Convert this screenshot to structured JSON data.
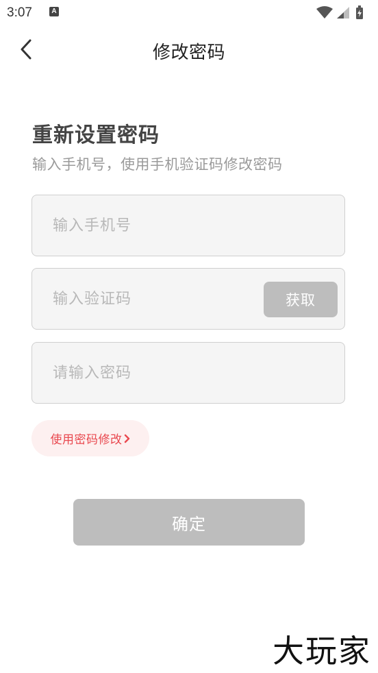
{
  "status_bar": {
    "time": "3:07",
    "notification_icon": "a-notification-icon",
    "notification_letter": "A",
    "icons": [
      "wifi-icon",
      "cell-signal-icon",
      "battery-icon"
    ]
  },
  "header": {
    "title": "修改密码",
    "back_icon": "chevron-left-icon"
  },
  "main": {
    "heading": "重新设置密码",
    "subheading": "输入手机号，使用手机验证码修改密码",
    "phone_input": {
      "placeholder": "输入手机号",
      "value": ""
    },
    "code_input": {
      "placeholder": "输入验证码",
      "value": ""
    },
    "get_code_label": "获取",
    "password_input": {
      "placeholder": "请输入密码",
      "value": ""
    },
    "password_mode_link": "使用密码修改",
    "confirm_label": "确定"
  },
  "watermark": "大玩家",
  "colors": {
    "accent_red": "#e9484f",
    "disabled_gray": "#bdbdbd",
    "field_bg": "#f5f5f5"
  }
}
